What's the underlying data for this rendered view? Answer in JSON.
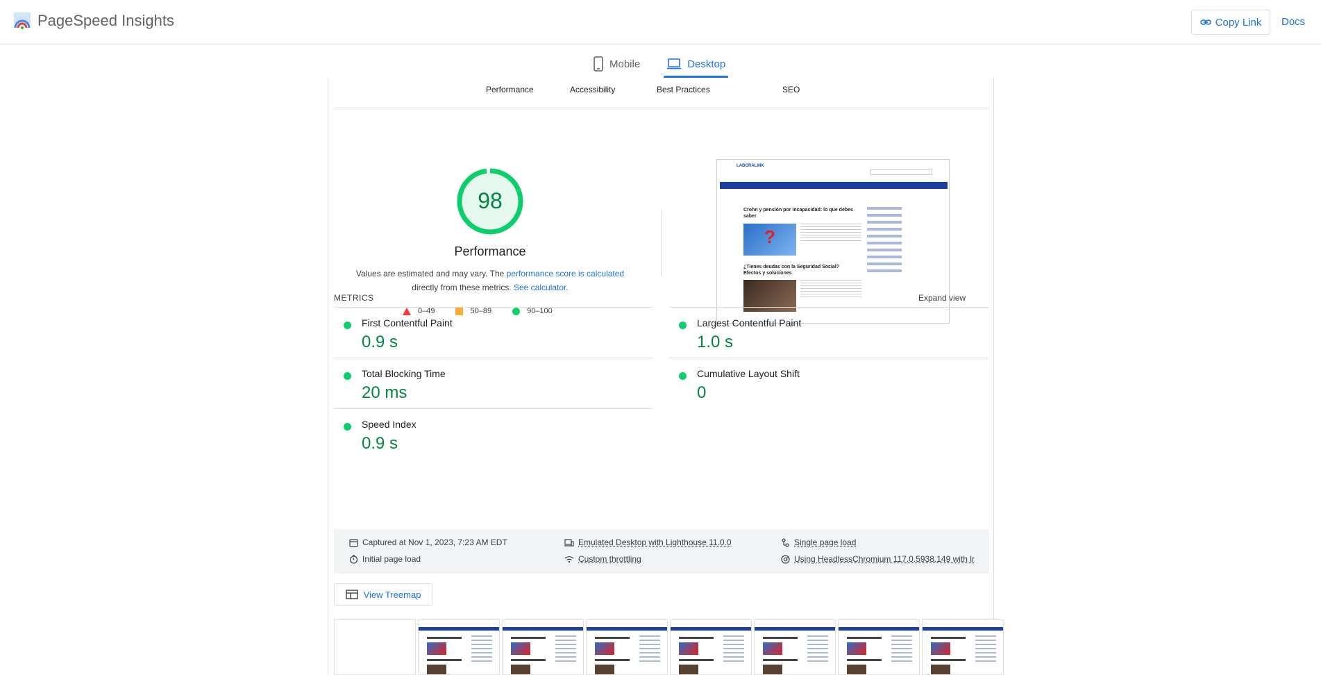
{
  "header": {
    "app_name": "PageSpeed Insights",
    "copy_link": "Copy Link",
    "docs": "Docs"
  },
  "device_tabs": {
    "mobile": "Mobile",
    "desktop": "Desktop",
    "active": "desktop"
  },
  "category_tabs": [
    "Performance",
    "Accessibility",
    "Best Practices",
    "SEO"
  ],
  "score": {
    "value": "98",
    "title": "Performance",
    "desc_pre": "Values are estimated and may vary. The ",
    "desc_link1": "performance score is calculated",
    "desc_mid": "directly from these metrics. ",
    "desc_link2": "See calculator",
    "desc_end": ".",
    "ring_fraction": 0.98,
    "color": "#0cce6b"
  },
  "legend": {
    "fail": "0–49",
    "average": "50–89",
    "pass": "90–100"
  },
  "screenshot": {
    "logo": "LABORALINK",
    "post1_title": "Crohn y pensión por incapacidad: lo que debes saber",
    "post2_title": "¿Tienes deudas con la Seguridad Social? Efectos y soluciones"
  },
  "metrics": {
    "label": "METRICS",
    "expand": "Expand view",
    "items": [
      {
        "name": "First Contentful Paint",
        "value": "0.9 s"
      },
      {
        "name": "Largest Contentful Paint",
        "value": "1.0 s"
      },
      {
        "name": "Total Blocking Time",
        "value": "20 ms"
      },
      {
        "name": "Cumulative Layout Shift",
        "value": "0"
      },
      {
        "name": "Speed Index",
        "value": "0.9 s"
      }
    ]
  },
  "runtime": {
    "captured": "Captured at Nov 1, 2023, 7:23 AM EDT",
    "initial_load": "Initial page load",
    "emulated": "Emulated Desktop with Lighthouse 11.0.0",
    "throttling": "Custom throttling",
    "single_page": "Single page load",
    "browser": "Using HeadlessChromium 117.0.5938.149 with lr"
  },
  "treemap": "View Treemap",
  "colors": {
    "accent": "#1a73e8",
    "pass": "#0cce6b",
    "pass_text": "#018642"
  }
}
